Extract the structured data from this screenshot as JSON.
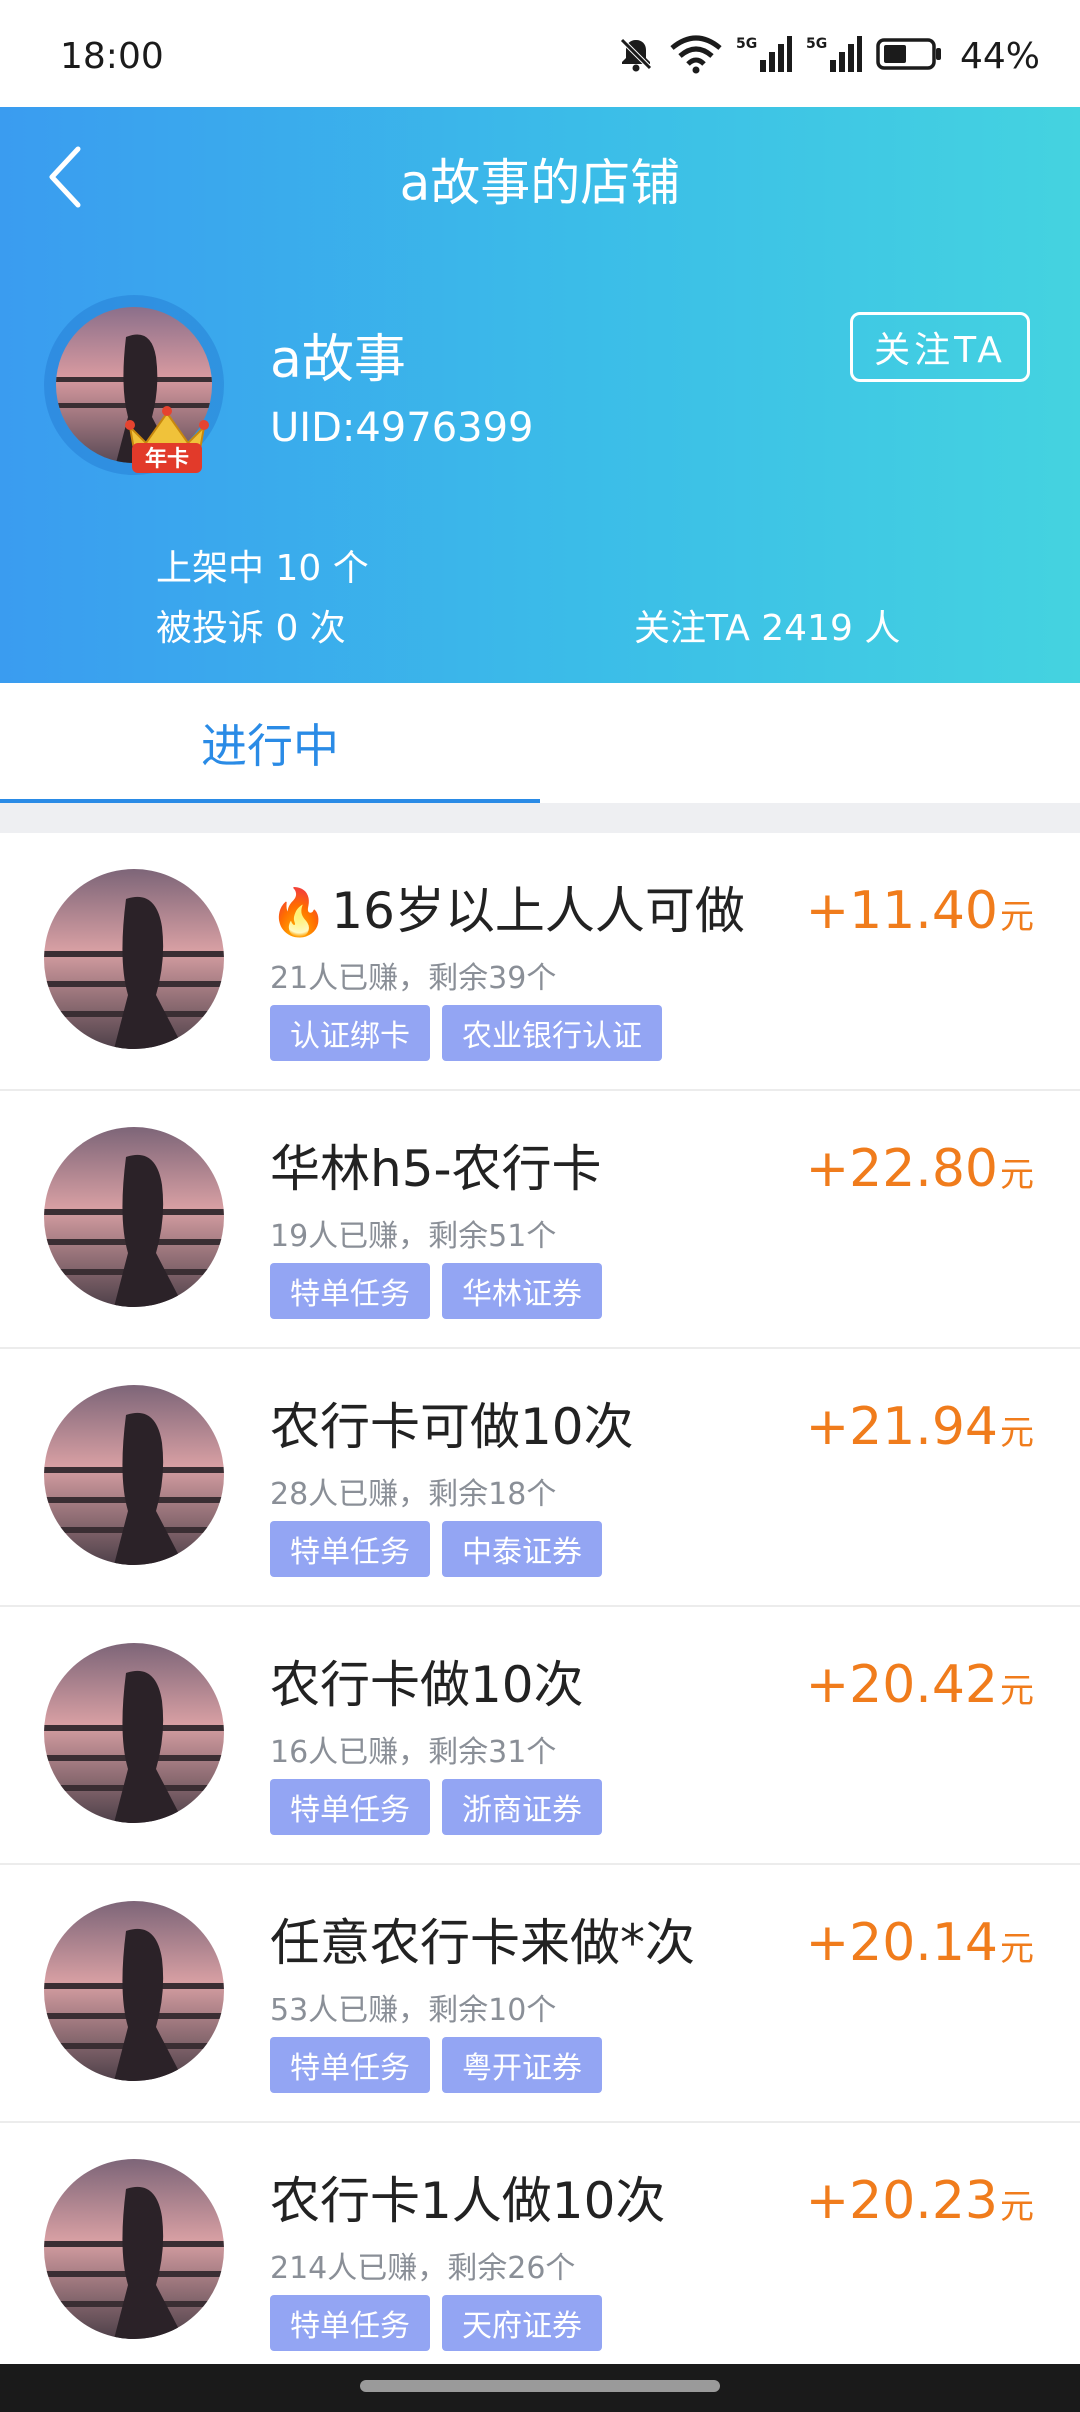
{
  "status_bar": {
    "time": "18:00",
    "battery": "44%"
  },
  "header": {
    "title": "a故事的店铺",
    "user_name": "a故事",
    "uid": "UID:4976399",
    "follow_button": "关注TA",
    "badge_text": "年卡",
    "stats": {
      "listed": "上架中 10 个",
      "complaints": "被投诉 0 次",
      "followers": "关注TA 2419 人"
    }
  },
  "tabs": {
    "active": "进行中"
  },
  "tasks": [
    {
      "title": "16岁以上人人可做",
      "has_fire": true,
      "meta": "21人已赚，剩余39个",
      "tags": [
        "认证绑卡",
        "农业银行认证"
      ],
      "reward": "+11.40",
      "unit": "元"
    },
    {
      "title": "华林h5-农行卡",
      "has_fire": false,
      "meta": "19人已赚，剩余51个",
      "tags": [
        "特单任务",
        "华林证券"
      ],
      "reward": "+22.80",
      "unit": "元"
    },
    {
      "title": "农行卡可做10次",
      "has_fire": false,
      "meta": "28人已赚，剩余18个",
      "tags": [
        "特单任务",
        "中泰证券"
      ],
      "reward": "+21.94",
      "unit": "元"
    },
    {
      "title": "农行卡做10次",
      "has_fire": false,
      "meta": "16人已赚，剩余31个",
      "tags": [
        "特单任务",
        "浙商证券"
      ],
      "reward": "+20.42",
      "unit": "元"
    },
    {
      "title": "任意农行卡来做*次",
      "has_fire": false,
      "meta": "53人已赚，剩余10个",
      "tags": [
        "特单任务",
        "粤开证券"
      ],
      "reward": "+20.14",
      "unit": "元"
    },
    {
      "title": "农行卡1人做10次",
      "has_fire": false,
      "meta": "214人已赚，剩余26个",
      "tags": [
        "特单任务",
        "天府证券"
      ],
      "reward": "+20.23",
      "unit": "元"
    }
  ],
  "colors": {
    "accent": "#2a8be6",
    "reward": "#f07c1c",
    "tag_bg": "#93a5f3"
  },
  "icons": [
    "mute-bell-icon",
    "wifi-icon",
    "signal-5g-icon",
    "battery-icon",
    "back-arrow-icon",
    "crown-icon",
    "fire-icon"
  ]
}
